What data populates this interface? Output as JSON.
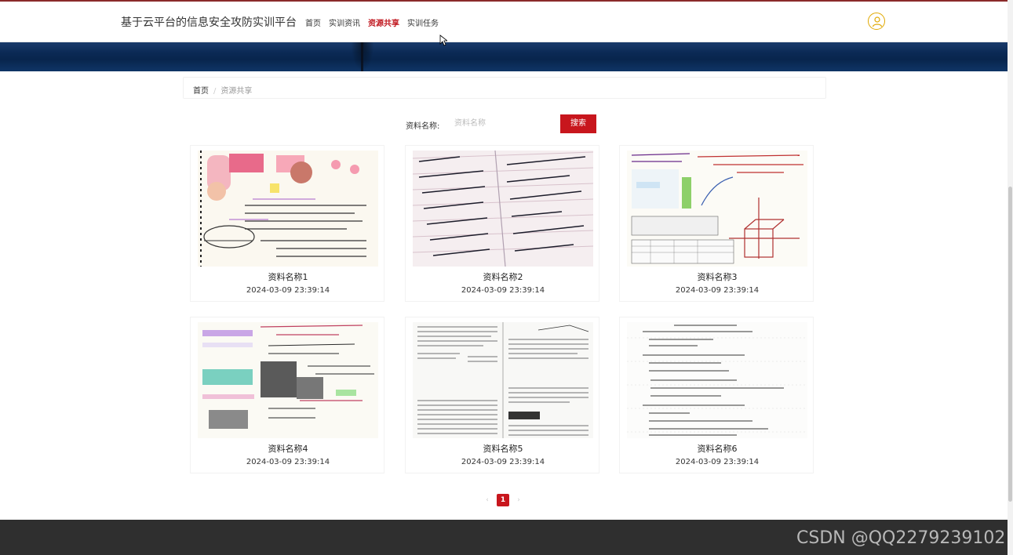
{
  "header": {
    "site_title": "基于云平台的信息安全攻防实训平台",
    "nav": [
      {
        "label": "首页",
        "active": false
      },
      {
        "label": "实训资讯",
        "active": false
      },
      {
        "label": "资源共享",
        "active": true
      },
      {
        "label": "实训任务",
        "active": false
      }
    ],
    "avatar_icon": "user-circle-icon",
    "accent_color": "#c8161d"
  },
  "breadcrumb": {
    "home": "首页",
    "separator": "/",
    "current": "资源共享"
  },
  "search": {
    "label": "资料名称:",
    "placeholder": "资料名称",
    "button": "搜索"
  },
  "resources": [
    {
      "name": "资料名称1",
      "date": "2024-03-09 23:39:14"
    },
    {
      "name": "资料名称2",
      "date": "2024-03-09 23:39:14"
    },
    {
      "name": "资料名称3",
      "date": "2024-03-09 23:39:14"
    },
    {
      "name": "资料名称4",
      "date": "2024-03-09 23:39:14"
    },
    {
      "name": "资料名称5",
      "date": "2024-03-09 23:39:14"
    },
    {
      "name": "资料名称6",
      "date": "2024-03-09 23:39:14"
    }
  ],
  "pagination": {
    "prev": "‹",
    "current_page": "1",
    "next": "›"
  },
  "watermark": "CSDN @QQ2279239102"
}
